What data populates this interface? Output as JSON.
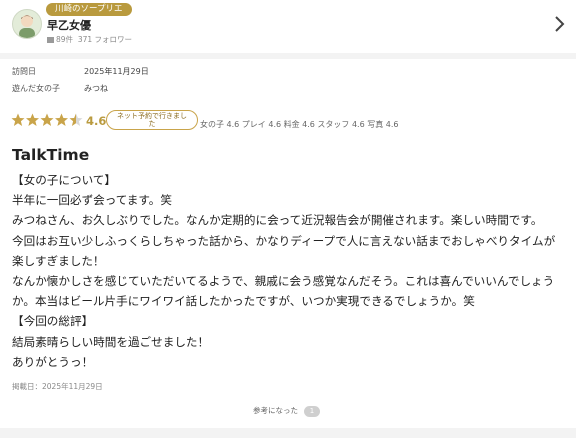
{
  "reviewer": {
    "badge": "川崎のソープリエ",
    "name": "早乙女優",
    "reviews_count": "89件",
    "followers": "371 フォロワー"
  },
  "visit": {
    "date_label": "訪問日",
    "date_value": "2025年11月29日",
    "girl_label": "遊んだ女の子",
    "girl_value": "みつね"
  },
  "rating": {
    "score": "4.6",
    "stars": 4.5,
    "reservation_tag_line1": "ネット予約で行きまし",
    "reservation_tag_line2": "た",
    "sub_scores": "女の子 4.6 プレイ 4.6 料金 4.6 スタッフ 4.6 写真 4.6"
  },
  "review": {
    "title": "TalkTime",
    "lines": [
      "【女の子について】",
      "半年に一回必ず会ってます。笑",
      "みつねさん、お久しぶりでした。なんか定期的に会って近況報告会が開催されます。楽しい時間です。",
      "今回はお互い少しふっくらしちゃった話から、かなりディープで人に言えない話までおしゃべりタイムが",
      "楽しすぎました！",
      "なんか懐かしさを感じていただいてるようで、親戚に会う感覚なんだそう。これは喜んでいいんでしょう",
      "か。本当はビール片手にワイワイ話したかったですが、いつか実現できるでしょうか。笑",
      "【今回の総評】",
      "結局素晴らしい時間を過ごせました！",
      "ありがとうっ！"
    ],
    "posted": "掲載日：2025年11月29日"
  },
  "helpful": {
    "label": "参考になった",
    "count": "1"
  },
  "colors": {
    "accent_gold": "#b99a3e",
    "star_gold": "#c9a44a"
  }
}
